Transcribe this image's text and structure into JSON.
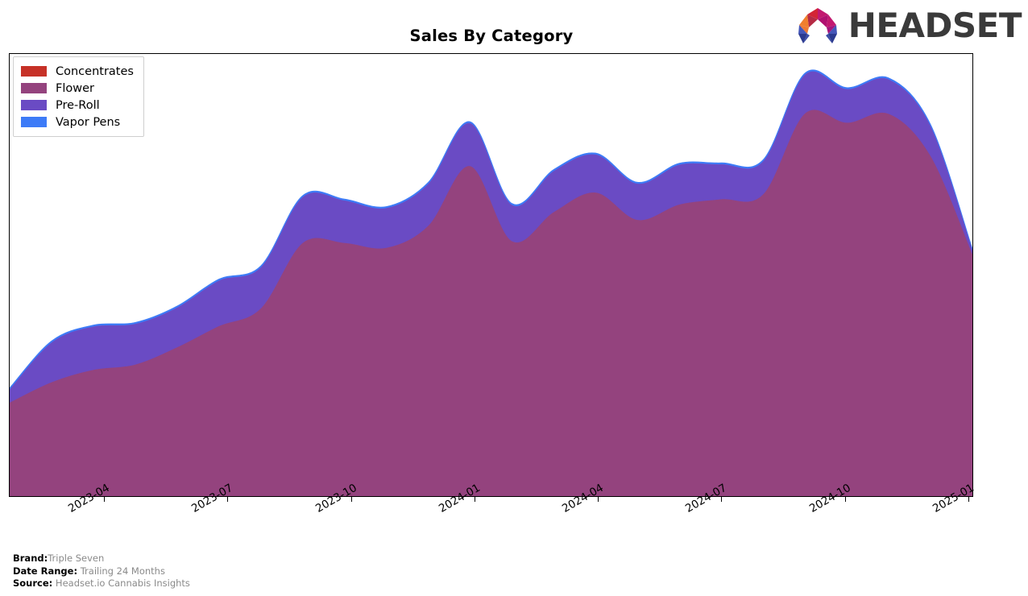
{
  "header": {
    "title": "Sales By Category",
    "logo_wordmark": "HEADSET",
    "logo_colors": {
      "orange": "#F07F2D",
      "red": "#D32434",
      "magenta": "#C2186F",
      "blue_dark": "#2B3A8F",
      "blue_mid": "#4456B8",
      "purple": "#7B2B9E"
    }
  },
  "legend": {
    "position": "top-left",
    "items": [
      {
        "label": "Concentrates",
        "color": "#C63127"
      },
      {
        "label": "Flower",
        "color": "#94437E"
      },
      {
        "label": "Pre-Roll",
        "color": "#6A4BC4"
      },
      {
        "label": "Vapor Pens",
        "color": "#3D7BF7"
      }
    ]
  },
  "footer": {
    "rows": [
      {
        "key": "Brand:",
        "value": "Triple Seven"
      },
      {
        "key": "Date Range:",
        "value": "Trailing 24 Months"
      },
      {
        "key": "Source:",
        "value": "Headset.io Cannabis Insights"
      }
    ]
  },
  "chart_data": {
    "type": "area",
    "title": "Sales By Category",
    "xlabel": "",
    "ylabel": "",
    "stacked": true,
    "grid": false,
    "legend_position": "upper left",
    "axis": {
      "y_ticks_visible": false,
      "x_tick_rotation": -30,
      "ylim": [
        0,
        1.0
      ],
      "x_range": [
        "2023-01",
        "2025-01"
      ]
    },
    "x_tick_labels": [
      "2023-04",
      "2023-07",
      "2023-10",
      "2024-01",
      "2024-04",
      "2024-07",
      "2024-10",
      "2025-01"
    ],
    "x_tick_positions": [
      0.125,
      0.2917,
      0.4583,
      0.625,
      0.7917,
      0.9583,
      1.125,
      1.2917
    ],
    "x": [
      "2023-01",
      "2023-02",
      "2023-03",
      "2023-04",
      "2023-05",
      "2023-06",
      "2023-07",
      "2023-08",
      "2023-09",
      "2023-10",
      "2023-11",
      "2023-12",
      "2024-01",
      "2024-02",
      "2024-03",
      "2024-04",
      "2024-05",
      "2024-06",
      "2024-07",
      "2024-08",
      "2024-09",
      "2024-10",
      "2024-11",
      "2024-12"
    ],
    "series": [
      {
        "name": "Concentrates",
        "color": "#C63127",
        "values": [
          0,
          0,
          0,
          0,
          0,
          0,
          0,
          0,
          0,
          0,
          0,
          0,
          0,
          0,
          0,
          0,
          0,
          0,
          0,
          0,
          0,
          0,
          0,
          0
        ]
      },
      {
        "name": "Flower",
        "color": "#94443F",
        "fill": "#94437E",
        "values": [
          0.212,
          0.258,
          0.286,
          0.298,
          0.337,
          0.385,
          0.425,
          0.573,
          0.573,
          0.562,
          0.612,
          0.747,
          0.577,
          0.643,
          0.687,
          0.625,
          0.66,
          0.672,
          0.683,
          0.866,
          0.845,
          0.865,
          0.77,
          0.548
        ]
      },
      {
        "name": "Pre-Roll",
        "color": "#6A4BC4",
        "values": [
          0.03,
          0.09,
          0.098,
          0.092,
          0.09,
          0.103,
          0.093,
          0.104,
          0.096,
          0.09,
          0.095,
          0.097,
          0.082,
          0.093,
          0.086,
          0.082,
          0.09,
          0.079,
          0.075,
          0.088,
          0.076,
          0.078,
          0.068,
          0.01
        ]
      },
      {
        "name": "Vapor Pens",
        "color": "#3D7BF7",
        "values": [
          0.003,
          0.003,
          0.003,
          0.003,
          0.003,
          0.003,
          0.003,
          0.003,
          0.003,
          0.003,
          0.003,
          0.003,
          0.003,
          0.003,
          0.003,
          0.003,
          0.003,
          0.003,
          0.003,
          0.003,
          0.003,
          0.003,
          0.003,
          0.002
        ]
      }
    ]
  }
}
